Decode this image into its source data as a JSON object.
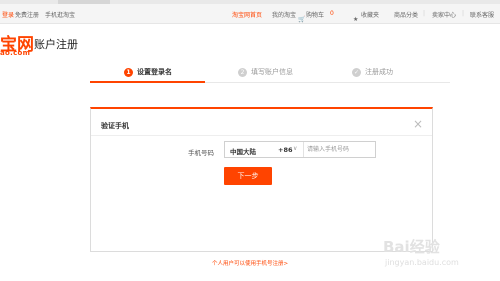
{
  "topbar": {
    "left_links": [
      "登录",
      "免费注册",
      "手机逛淘宝"
    ],
    "right_links": {
      "home": "淘宝网首页",
      "my_taobao": "我的淘宝",
      "cart": "购物车",
      "cart_count": "0",
      "favorites": "收藏夹",
      "categories": "商品分类",
      "seller_center": "卖家中心",
      "contact": "联系客服"
    }
  },
  "logo": {
    "text": "宝网",
    "subtext": "ao.com"
  },
  "page_title": "账户注册",
  "steps": [
    {
      "num": "1",
      "label": "设置登录名"
    },
    {
      "num": "2",
      "label": "填写账户信息"
    },
    {
      "label": "注册成功"
    }
  ],
  "card": {
    "title": "验证手机",
    "phone_label": "手机号码",
    "country": "中国大陆",
    "country_code": "+86",
    "phone_placeholder": "请输入手机号码",
    "next_label": "下一步"
  },
  "footer_link": "个人用户可以使用手机号注册>",
  "watermark": {
    "main": "Bai经验",
    "sub": "jingyan.baidu.com"
  },
  "colors": {
    "accent": "#ff4400",
    "step_inactive": "#cfcfcf"
  },
  "icons": {
    "cart": "cart-icon",
    "favorites": "star-icon",
    "dropdown": "chevron-down-icon",
    "close": "close-icon",
    "done": "check-circle-icon"
  }
}
